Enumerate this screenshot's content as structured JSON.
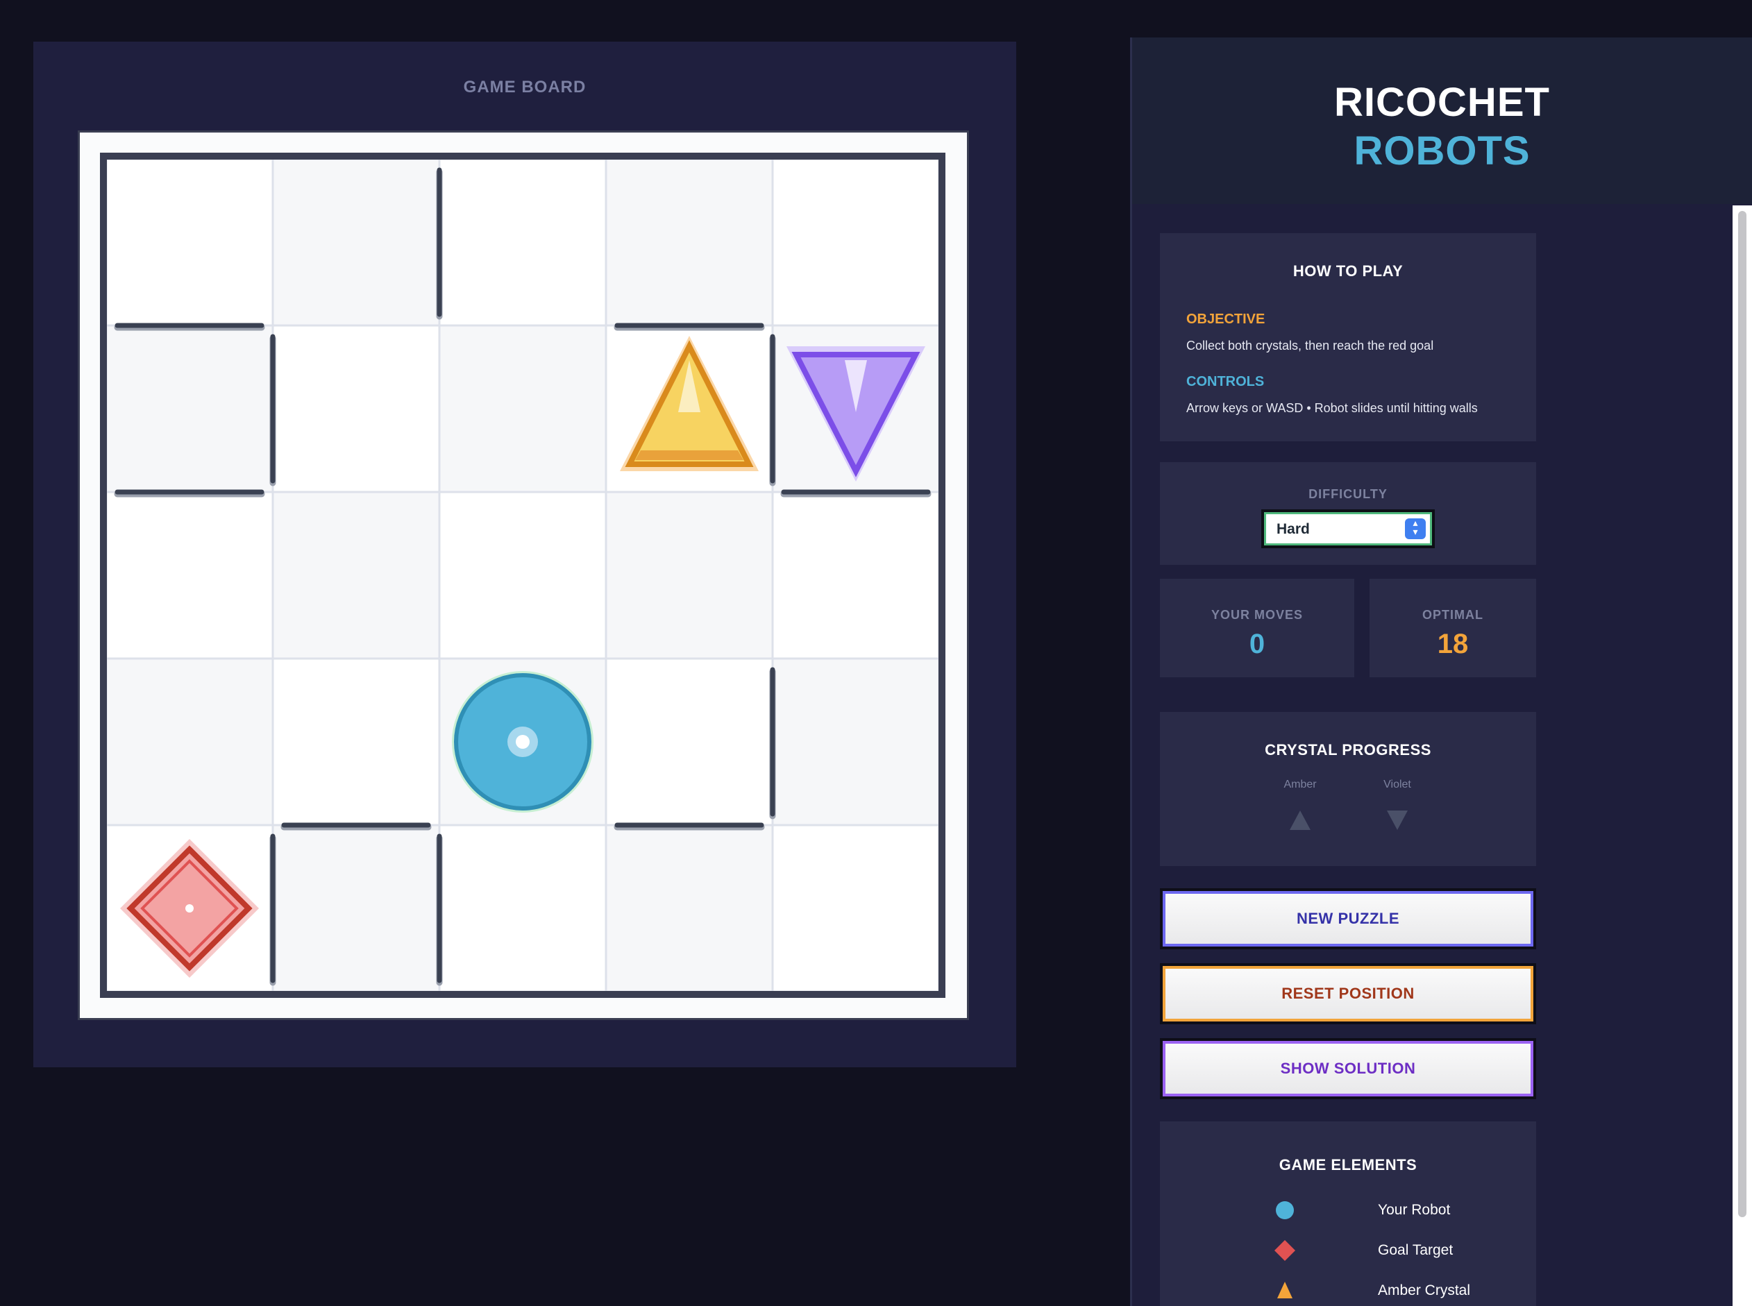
{
  "board": {
    "title": "GAME BOARD",
    "rows": 5,
    "cols": 5,
    "robot": {
      "row": 3,
      "col": 2,
      "color": "#4fb3d9"
    },
    "goal": {
      "row": 4,
      "col": 0,
      "color": "#e05252"
    },
    "crystals": [
      {
        "name": "Amber",
        "row": 1,
        "col": 3,
        "color": "#f3a43a",
        "shape": "triangle-up"
      },
      {
        "name": "Violet",
        "row": 1,
        "col": 4,
        "color": "#8b5cf6",
        "shape": "triangle-down"
      }
    ],
    "walls": [
      {
        "side": "right",
        "row": 0,
        "col": 1
      },
      {
        "side": "bottom",
        "row": 0,
        "col": 0
      },
      {
        "side": "bottom",
        "row": 0,
        "col": 3
      },
      {
        "side": "right",
        "row": 1,
        "col": 0
      },
      {
        "side": "right",
        "row": 1,
        "col": 3
      },
      {
        "side": "bottom",
        "row": 1,
        "col": 0
      },
      {
        "side": "bottom",
        "row": 1,
        "col": 4
      },
      {
        "side": "right",
        "row": 3,
        "col": 3
      },
      {
        "side": "bottom",
        "row": 3,
        "col": 1
      },
      {
        "side": "bottom",
        "row": 3,
        "col": 3
      },
      {
        "side": "right",
        "row": 4,
        "col": 0
      },
      {
        "side": "right",
        "row": 4,
        "col": 1
      }
    ]
  },
  "sidebar": {
    "title_line1": "RICOCHET",
    "title_line2": "ROBOTS",
    "how_to_play": {
      "title": "HOW TO PLAY",
      "objective_label": "OBJECTIVE",
      "objective_text": "Collect both crystals, then reach the red goal",
      "controls_label": "CONTROLS",
      "controls_text": "Arrow keys or WASD • Robot slides until hitting walls"
    },
    "difficulty": {
      "label": "DIFFICULTY",
      "value": "Hard"
    },
    "stats": {
      "moves_label": "YOUR MOVES",
      "moves_value": "0",
      "optimal_label": "OPTIMAL",
      "optimal_value": "18"
    },
    "crystal_progress": {
      "title": "CRYSTAL PROGRESS",
      "amber": "Amber",
      "violet": "Violet"
    },
    "buttons": {
      "new": "NEW PUZZLE",
      "reset": "RESET POSITION",
      "solve": "SHOW SOLUTION"
    },
    "elements": {
      "title": "GAME ELEMENTS",
      "robot": "Your Robot",
      "goal": "Goal Target",
      "amber": "Amber Crystal"
    }
  }
}
